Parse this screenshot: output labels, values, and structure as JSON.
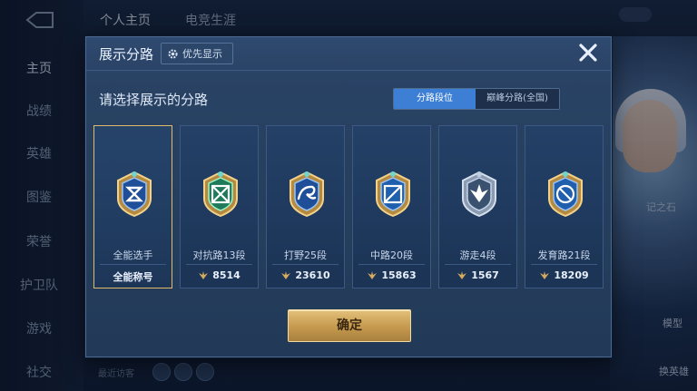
{
  "background": {
    "nav_items": [
      "主页",
      "战绩",
      "英雄",
      "图鉴",
      "荣誉",
      "护卫队",
      "游戏",
      "社交"
    ],
    "top_tabs": [
      "个人主页",
      "电竞生涯"
    ],
    "right_labels": [
      "记之石",
      "模型",
      "换英雄"
    ],
    "recent_visitors": "最近访客"
  },
  "modal": {
    "title": "展示分路",
    "priority_button": "优先显示",
    "subtitle": "请选择展示的分路",
    "segment": {
      "active": "分路段位",
      "inactive": "巅峰分路(全国)"
    },
    "cards": [
      {
        "name": "全能选手",
        "value": "全能称号",
        "icon": "all-round-badge-icon",
        "selected": true
      },
      {
        "name": "对抗路13段",
        "value": "8514",
        "icon": "clash-lane-badge-icon",
        "selected": false
      },
      {
        "name": "打野25段",
        "value": "23610",
        "icon": "jungle-badge-icon",
        "selected": false
      },
      {
        "name": "中路20段",
        "value": "15863",
        "icon": "mid-lane-badge-icon",
        "selected": false
      },
      {
        "name": "游走4段",
        "value": "1567",
        "icon": "roam-badge-icon",
        "selected": false
      },
      {
        "name": "发育路21段",
        "value": "18209",
        "icon": "farm-lane-badge-icon",
        "selected": false
      }
    ],
    "confirm_button": "确定"
  },
  "colors": {
    "accent": "#3d7fd4",
    "gold": "#d4ab5f",
    "selected_border": "#e0bb6c"
  }
}
